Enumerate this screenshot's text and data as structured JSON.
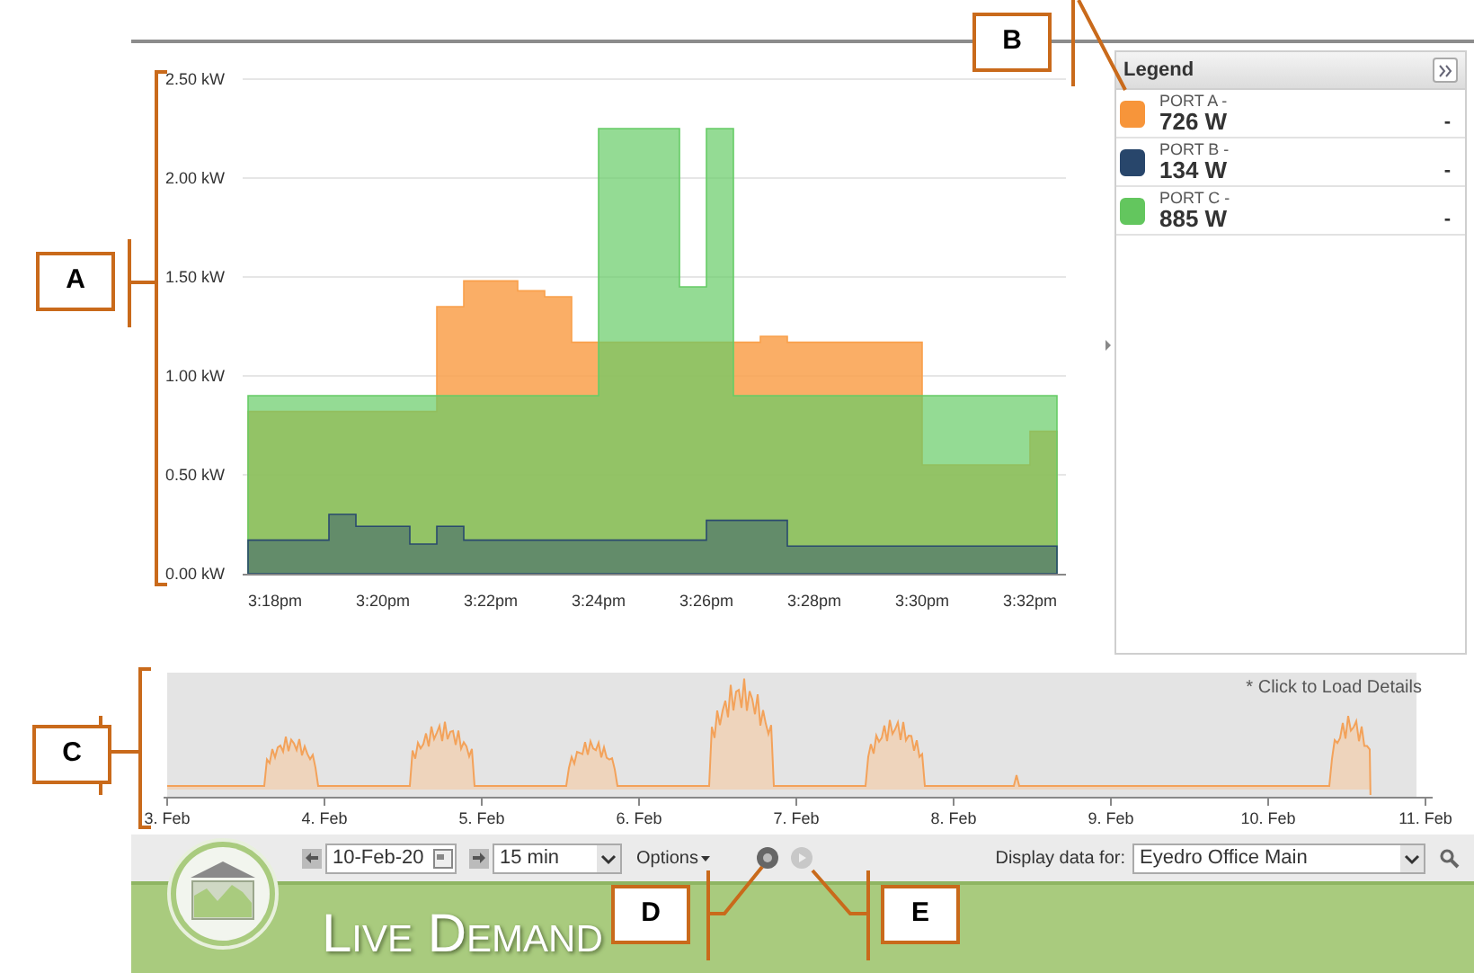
{
  "callouts": [
    {
      "label": "A"
    },
    {
      "label": "B"
    },
    {
      "label": "C"
    },
    {
      "label": "D"
    },
    {
      "label": "E"
    }
  ],
  "main_chart": {
    "chart_data": {
      "type": "area",
      "grid": true,
      "categories": [
        null,
        "3:18pm",
        null,
        null,
        null,
        "3:20pm",
        null,
        null,
        null,
        "3:22pm",
        null,
        null,
        null,
        "3:24pm",
        null,
        null,
        null,
        "3:26pm",
        null,
        null,
        null,
        "3:28pm",
        null,
        null,
        null,
        "3:30pm",
        null,
        null,
        null,
        "3:32pm",
        null
      ],
      "yticks": [
        {
          "value": 0,
          "label": "0.00 kW"
        },
        {
          "value": 0.5,
          "label": "0.50 kW"
        },
        {
          "value": 1,
          "label": "1.00 kW"
        },
        {
          "value": 1.5,
          "label": "1.50 kW"
        },
        {
          "value": 2,
          "label": "2.00 kW"
        },
        {
          "value": 2.5,
          "label": "2.50 kW"
        }
      ],
      "ylim": [
        0,
        2.5
      ],
      "series": [
        {
          "color": "#f9a04b",
          "values": [
            0.82,
            0.82,
            0.82,
            0.82,
            0.82,
            0.82,
            0.82,
            1.35,
            1.48,
            1.48,
            1.43,
            1.4,
            1.17,
            1.17,
            1.17,
            1.17,
            1.17,
            1.17,
            1.17,
            1.2,
            1.17,
            1.17,
            1.17,
            1.17,
            1.17,
            0.55,
            0.55,
            0.55,
            0.55,
            0.72,
            0.72
          ]
        },
        {
          "color": "#66cc66",
          "values": [
            0.9,
            0.9,
            0.9,
            0.9,
            0.9,
            0.9,
            0.9,
            0.9,
            0.9,
            0.9,
            0.9,
            0.9,
            0.9,
            2.25,
            2.25,
            2.25,
            1.45,
            2.25,
            0.9,
            0.9,
            0.9,
            0.9,
            0.9,
            0.9,
            0.9,
            0.9,
            0.9,
            0.9,
            0.9,
            0.9,
            0.9
          ]
        },
        {
          "color": "#2a4a6e",
          "values": [
            0.17,
            0.17,
            0.17,
            0.3,
            0.24,
            0.24,
            0.15,
            0.24,
            0.17,
            0.17,
            0.17,
            0.17,
            0.17,
            0.17,
            0.17,
            0.17,
            0.17,
            0.27,
            0.27,
            0.27,
            0.14,
            0.14,
            0.14,
            0.14,
            0.14,
            0.14,
            0.14,
            0.14,
            0.14,
            0.14,
            0.14
          ]
        }
      ]
    }
  },
  "legend": {
    "title": "Legend",
    "items": [
      {
        "name": "PORT A -",
        "value": "726 W",
        "trailing": "-",
        "color": "#f7953a"
      },
      {
        "name": "PORT B -",
        "value": "134 W",
        "trailing": "-",
        "color": "#28466b"
      },
      {
        "name": "PORT C -",
        "value": "885 W",
        "trailing": "-",
        "color": "#63c65e"
      }
    ]
  },
  "overview": {
    "note": "* Click to Load Details",
    "date_labels": [
      "3. Feb",
      "4. Feb",
      "5. Feb",
      "6. Feb",
      "7. Feb",
      "8. Feb",
      "9. Feb",
      "10. Feb",
      "11. Feb"
    ]
  },
  "toolbar": {
    "date": "10-Feb-20",
    "interval": "15 min",
    "options": "Options",
    "display_label": "Display data for:",
    "source": "Eyedro Office Main"
  },
  "banner": {
    "title": "Live Demand"
  }
}
